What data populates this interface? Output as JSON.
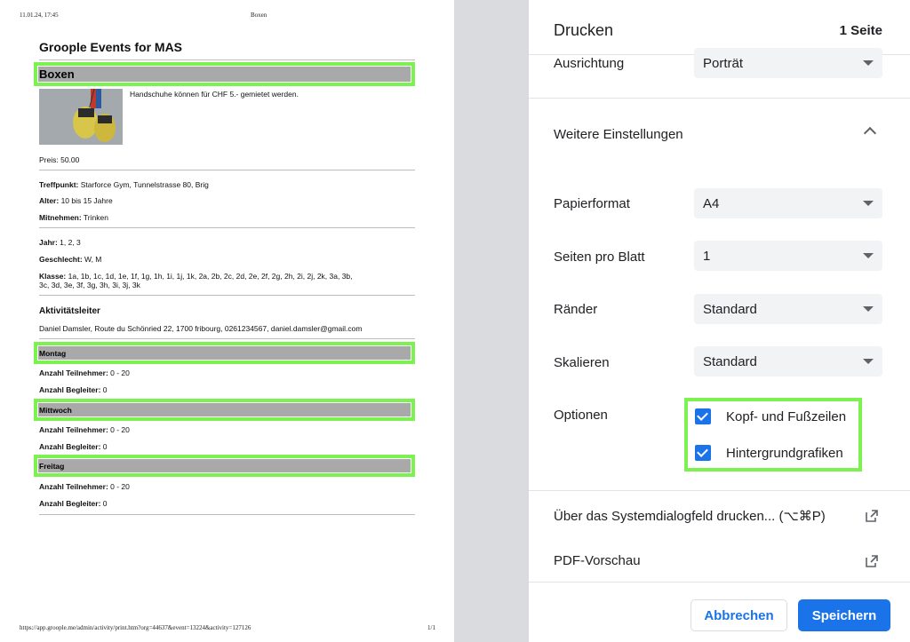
{
  "preview": {
    "header_left": "11.01.24, 17:45",
    "header_center": "Boxen",
    "footer_left": "https://app.groople.me/admin/activity/print.htm?org=44637&event=13224&activity=127126",
    "footer_right": "1/1",
    "site_title": "Groople Events for MAS",
    "activity_title": "Boxen",
    "description": "Handschuhe können für CHF 5.- gemietet werden.",
    "price": "Preis: 50.00",
    "meeting_label": "Treffpunkt:",
    "meeting_value": " Starforce Gym, Tunnelstrasse 80, Brig",
    "age_label": "Alter:",
    "age_value": " 10 bis 15 Jahre",
    "bring_label": "Mitnehmen:",
    "bring_value": " Trinken",
    "year_label": "Jahr:",
    "year_value": " 1, 2, 3",
    "gender_label": "Geschlecht:",
    "gender_value": " W, M",
    "class_label": "Klasse:",
    "class_value_1": " 1a, 1b, 1c, 1d, 1e, 1f, 1g, 1h, 1i, 1j, 1k, 2a, 2b, 2c, 2d, 2e, 2f, 2g, 2h, 2i, 2j, 2k, 3a, 3b,",
    "class_value_2": "3c, 3d, 3e, 3f, 3g, 3h, 3i, 3j, 3k",
    "leader_heading": "Aktivitätsleiter",
    "leader_value": "Daniel Damsler, Route du Schönried 22, 1700 fribourg, 0261234567, daniel.damsler@gmail.com",
    "days": [
      {
        "name": "Montag",
        "participants_label": "Anzahl Teilnehmer:",
        "participants_value": " 0 - 20",
        "companions_label": "Anzahl Begleiter:",
        "companions_value": " 0"
      },
      {
        "name": "Mittwoch",
        "participants_label": "Anzahl Teilnehmer:",
        "participants_value": " 0 - 20",
        "companions_label": "Anzahl Begleiter:",
        "companions_value": " 0"
      },
      {
        "name": "Freitag",
        "participants_label": "Anzahl Teilnehmer:",
        "participants_value": " 0 - 20",
        "companions_label": "Anzahl Begleiter:",
        "companions_value": " 0"
      }
    ]
  },
  "panel": {
    "title": "Drucken",
    "page_count": "1 Seite",
    "orientation_label": "Ausrichtung",
    "orientation_value": "Porträt",
    "more_settings": "Weitere Einstellungen",
    "paper_label": "Papierformat",
    "paper_value": "A4",
    "pps_label": "Seiten pro Blatt",
    "pps_value": "1",
    "margins_label": "Ränder",
    "margins_value": "Standard",
    "scale_label": "Skalieren",
    "scale_value": "Standard",
    "options_label": "Optionen",
    "opt_headers": "Kopf- und Fußzeilen",
    "opt_background": "Hintergrundgrafiken",
    "system_dialog": "Über das Systemdialogfeld drucken... (⌥⌘P)",
    "pdf_preview": "PDF-Vorschau",
    "cancel": "Abbrechen",
    "save": "Speichern"
  },
  "colors": {
    "accent": "#1a73e8",
    "highlight": "#7cf251",
    "bar": "#a9a9a9"
  }
}
